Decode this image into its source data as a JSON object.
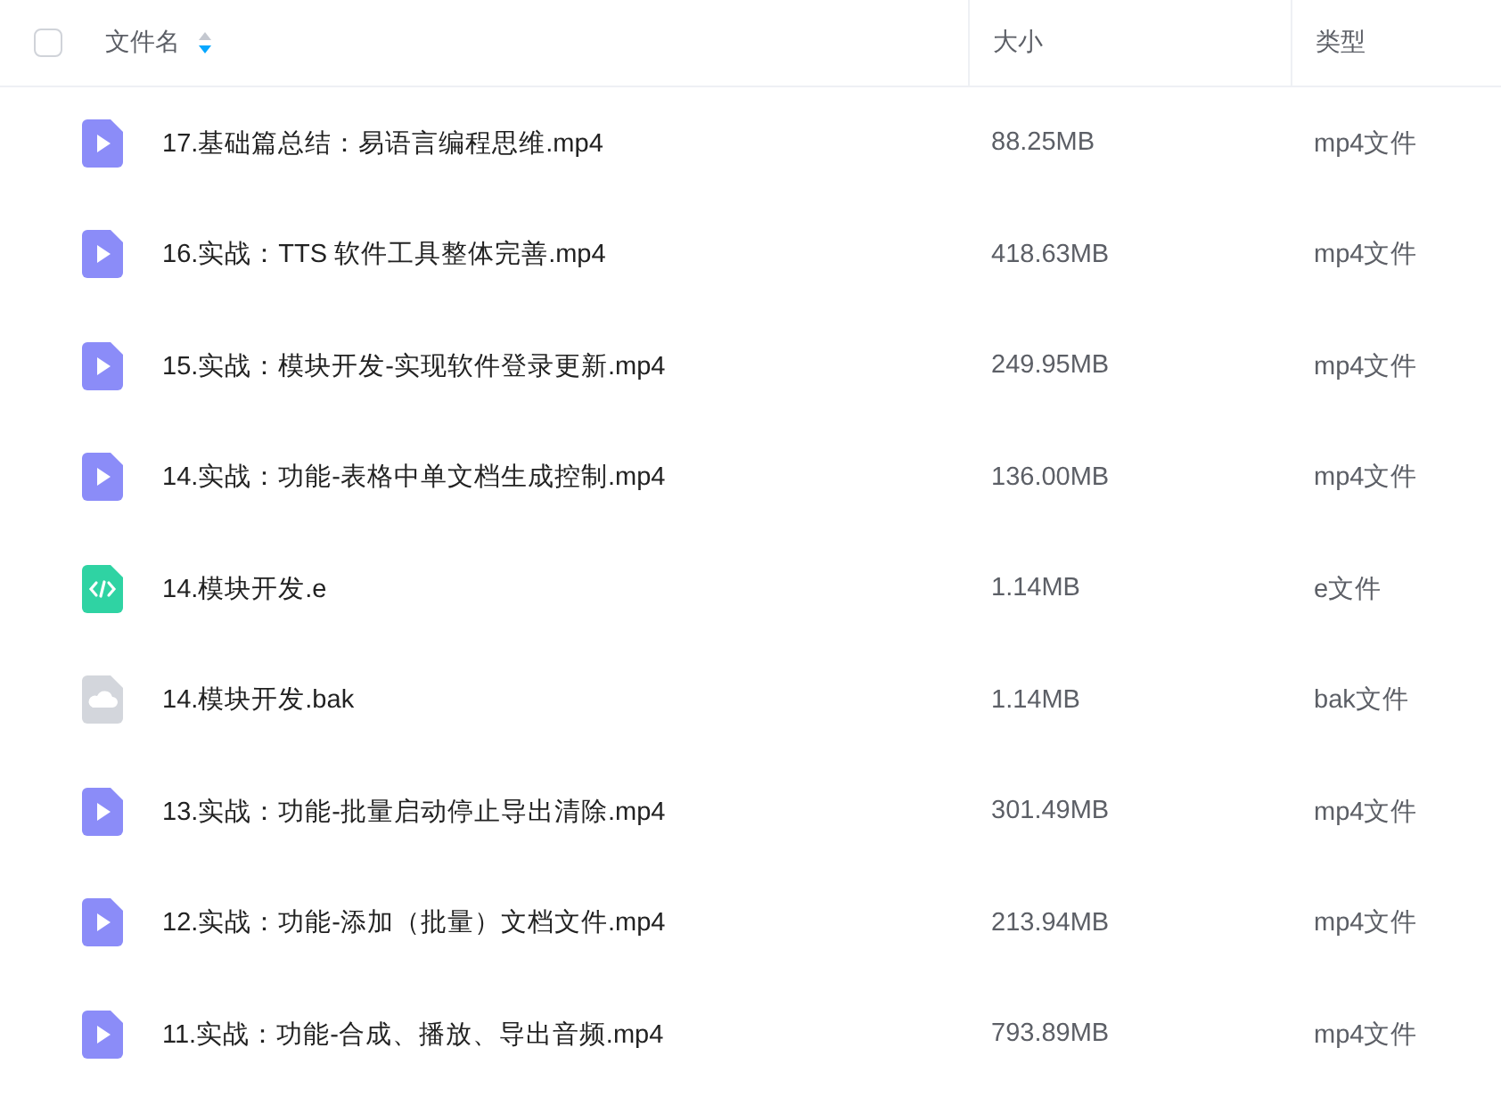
{
  "header": {
    "select_all": {
      "checked": false
    },
    "columns": [
      {
        "label": "文件名",
        "sort_descending": true
      },
      {
        "label": "大小"
      },
      {
        "label": "类型"
      }
    ]
  },
  "rows": [
    {
      "kind": "video",
      "name": "17.基础篇总结：易语言编程思维.mp4",
      "size": "88.25MB",
      "type": "mp4文件"
    },
    {
      "kind": "video",
      "name": "16.实战：TTS 软件工具整体完善.mp4",
      "size": "418.63MB",
      "type": "mp4文件"
    },
    {
      "kind": "video",
      "name": "15.实战：模块开发-实现软件登录更新.mp4",
      "size": "249.95MB",
      "type": "mp4文件"
    },
    {
      "kind": "video",
      "name": "14.实战：功能-表格中单文档生成控制.mp4",
      "size": "136.00MB",
      "type": "mp4文件"
    },
    {
      "kind": "code",
      "name": "14.模块开发.e",
      "size": "1.14MB",
      "type": "e文件"
    },
    {
      "kind": "cloud",
      "name": "14.模块开发.bak",
      "size": "1.14MB",
      "type": "bak文件"
    },
    {
      "kind": "video",
      "name": "13.实战：功能-批量启动停止导出清除.mp4",
      "size": "301.49MB",
      "type": "mp4文件"
    },
    {
      "kind": "video",
      "name": "12.实战：功能-添加（批量）文档文件.mp4",
      "size": "213.94MB",
      "type": "mp4文件"
    },
    {
      "kind": "video",
      "name": "11.实战：功能-合成、播放、导出音频.mp4",
      "size": "793.89MB",
      "type": "mp4文件"
    }
  ]
}
